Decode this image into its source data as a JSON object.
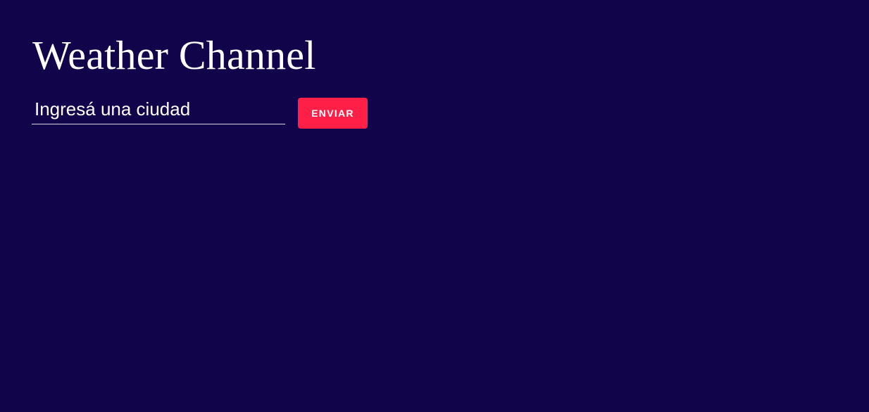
{
  "header": {
    "title": "Weather Channel"
  },
  "search": {
    "value": "",
    "placeholder": "Ingresá una ciudad",
    "submit_label": "ENVIAR"
  },
  "colors": {
    "background": "#12044a",
    "button": "#ff1f47",
    "text": "#ffffff"
  }
}
